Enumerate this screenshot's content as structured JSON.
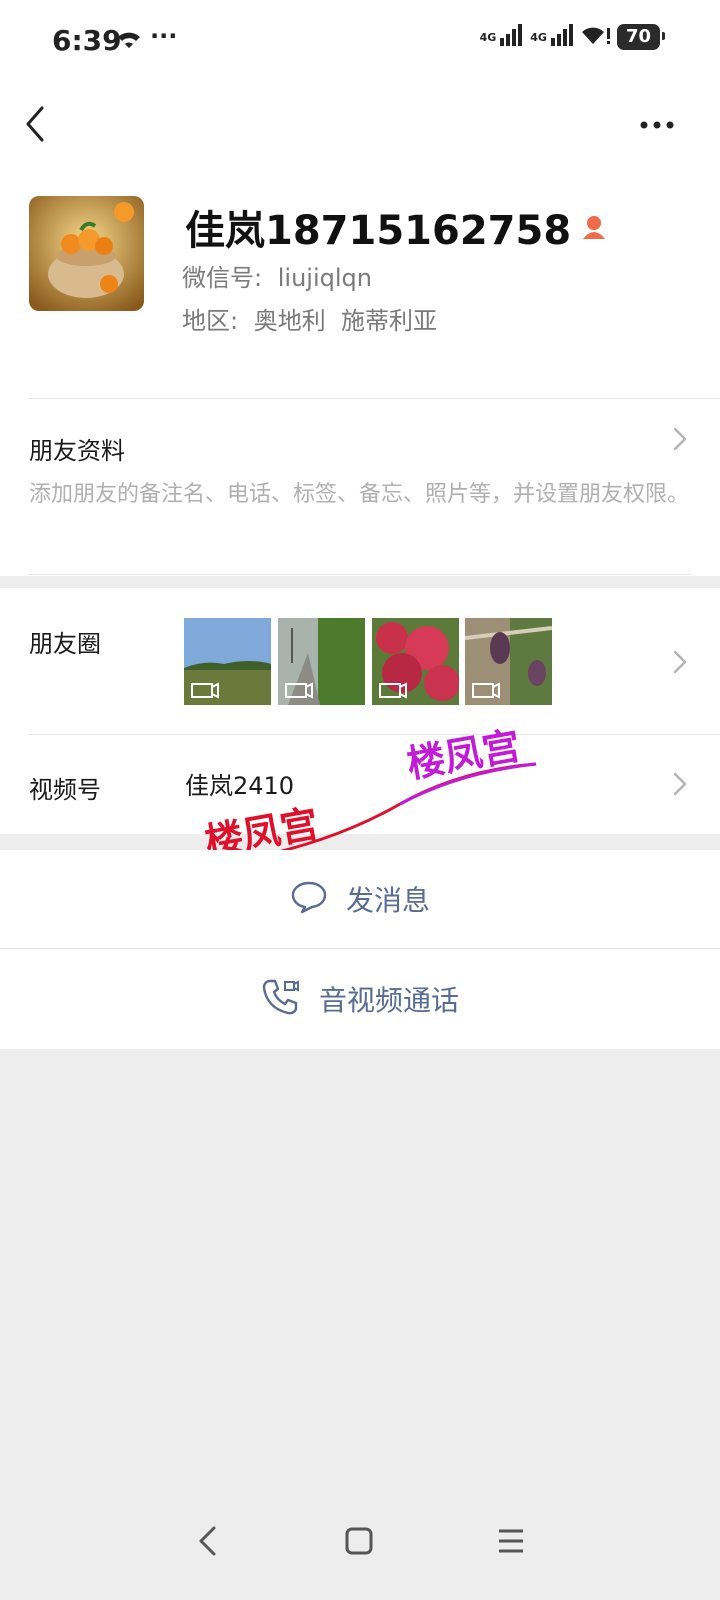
{
  "status_bar": {
    "time": "6:39",
    "net1": "4G",
    "net2": "4G",
    "battery": "70"
  },
  "profile": {
    "name": "佳岚18715162758",
    "wechat_id_label": "微信号:",
    "wechat_id": "liujiqlqn",
    "region_label": "地区:",
    "region": "奥地利  施蒂利亚"
  },
  "friend_info": {
    "title": "朋友资料",
    "description": "添加朋友的备注名、电话、标签、备忘、照片等，并设置朋友权限。"
  },
  "moments": {
    "title": "朋友圈",
    "thumbnails": [
      "video-thumbnail-field",
      "video-thumbnail-road",
      "video-thumbnail-flowers",
      "video-thumbnail-vine"
    ]
  },
  "channels": {
    "title": "视频号",
    "value": "佳岚2410"
  },
  "watermark": {
    "text1": "楼凤宫",
    "text2": "楼凤宫"
  },
  "actions": {
    "message": "发消息",
    "call": "音视频通话"
  },
  "colors": {
    "link_blue": "#576b95",
    "watermark_red": "#e0102a",
    "watermark_purple": "#c21ad6"
  }
}
